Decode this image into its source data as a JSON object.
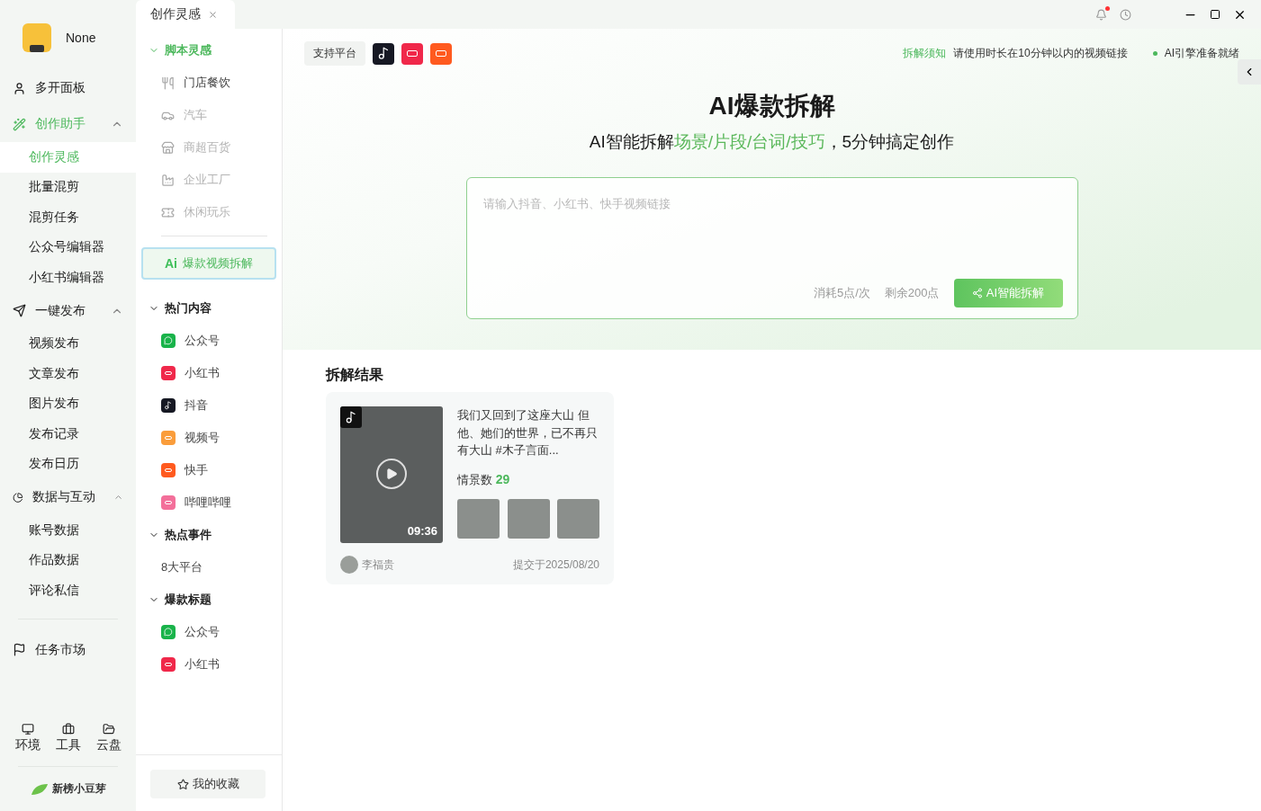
{
  "user": {
    "name": "None"
  },
  "nav": [
    {
      "kind": "link",
      "label": "多开面板",
      "selected": false
    },
    {
      "kind": "group",
      "label": "创作助手",
      "selected": true,
      "expanded": true,
      "children": [
        {
          "label": "创作灵感",
          "selected": true
        },
        {
          "label": "批量混剪",
          "selected": false
        },
        {
          "label": "混剪任务",
          "selected": false
        },
        {
          "label": "公众号编辑器",
          "selected": false
        },
        {
          "label": "小红书编辑器",
          "selected": false
        }
      ]
    },
    {
      "kind": "group",
      "label": "一键发布",
      "selected": false,
      "expanded": true,
      "children": [
        {
          "label": "视频发布",
          "selected": false
        },
        {
          "label": "文章发布",
          "selected": false
        },
        {
          "label": "图片发布",
          "selected": false
        },
        {
          "label": "发布记录",
          "selected": false
        },
        {
          "label": "发布日历",
          "selected": false
        }
      ]
    },
    {
      "kind": "group",
      "label": "数据与互动",
      "selected": false,
      "expanded": true,
      "children": [
        {
          "label": "账号数据",
          "selected": false
        },
        {
          "label": "作品数据",
          "selected": false
        },
        {
          "label": "评论私信",
          "selected": false
        }
      ]
    },
    {
      "kind": "divider"
    },
    {
      "kind": "link",
      "label": "任务市场",
      "selected": false
    }
  ],
  "tools": [
    "环境",
    "工具",
    "云盘"
  ],
  "brand": "新榜小豆芽",
  "tab": {
    "label": "创作灵感",
    "selected": true
  },
  "panel": {
    "sections": [
      {
        "kind": "list",
        "title": "脚本灵感",
        "selected": true,
        "expanded": true,
        "items": [
          {
            "kind": "scene",
            "label": "门店餐饮",
            "disabled": false
          },
          {
            "kind": "scene",
            "label": "汽车",
            "disabled": true
          },
          {
            "kind": "scene",
            "label": "商超百货",
            "disabled": true
          },
          {
            "kind": "scene",
            "label": "企业工厂",
            "disabled": true
          },
          {
            "kind": "scene",
            "label": "休闲玩乐",
            "disabled": true
          }
        ]
      },
      {
        "kind": "feature",
        "badge": "Ai",
        "label": "爆款视频拆解",
        "selected": true
      },
      {
        "kind": "list",
        "title": "热门内容",
        "selected": false,
        "expanded": true,
        "items": [
          {
            "kind": "wechat",
            "label": "公众号",
            "disabled": false
          },
          {
            "kind": "xhs",
            "label": "小红书",
            "disabled": false
          },
          {
            "kind": "douyin",
            "label": "抖音",
            "disabled": false
          },
          {
            "kind": "channels",
            "label": "视频号",
            "disabled": false
          },
          {
            "kind": "kuaishou",
            "label": "快手",
            "disabled": false
          },
          {
            "kind": "bilibili",
            "label": "哔哩哔哩",
            "disabled": false
          }
        ]
      },
      {
        "kind": "list",
        "title": "热点事件",
        "selected": false,
        "expanded": true,
        "items": [
          {
            "kind": "text",
            "label": "8大平台",
            "disabled": false
          }
        ]
      },
      {
        "kind": "list",
        "title": "爆款标题",
        "selected": false,
        "expanded": true,
        "items": [
          {
            "kind": "wechat",
            "label": "公众号",
            "disabled": false
          },
          {
            "kind": "xhs",
            "label": "小红书",
            "disabled": false
          }
        ]
      }
    ],
    "footer_button": "我的收藏"
  },
  "main": {
    "platforms_label": "支持平台",
    "notice": {
      "tag": "拆解须知",
      "text": "请使用时长在10分钟以内的视频链接"
    },
    "status": {
      "text": "AI引擎准备就绪",
      "ready": true
    },
    "title": "AI爆款拆解",
    "subtitle": [
      {
        "text": "AI智能拆解",
        "highlight": false
      },
      {
        "text": "场景/片段/台词/技巧",
        "highlight": true
      },
      {
        "text": "，5分钟搞定创作",
        "highlight": false
      }
    ],
    "input": {
      "placeholder": "请输入抖音、小红书、快手视频链接"
    },
    "cost": "消耗5点/次",
    "remaining": "剩余200点",
    "submit": "AI智能拆解",
    "results_title": "拆解结果",
    "results": [
      {
        "duration": "09:36",
        "description": "我们又回到了这座大山 但他、她们的世界，已不再只有大山 #木子言面...",
        "scene_label": "情景数",
        "scene_count": "29",
        "author": "李福贵",
        "date": "提交于2025/08/20"
      }
    ]
  }
}
